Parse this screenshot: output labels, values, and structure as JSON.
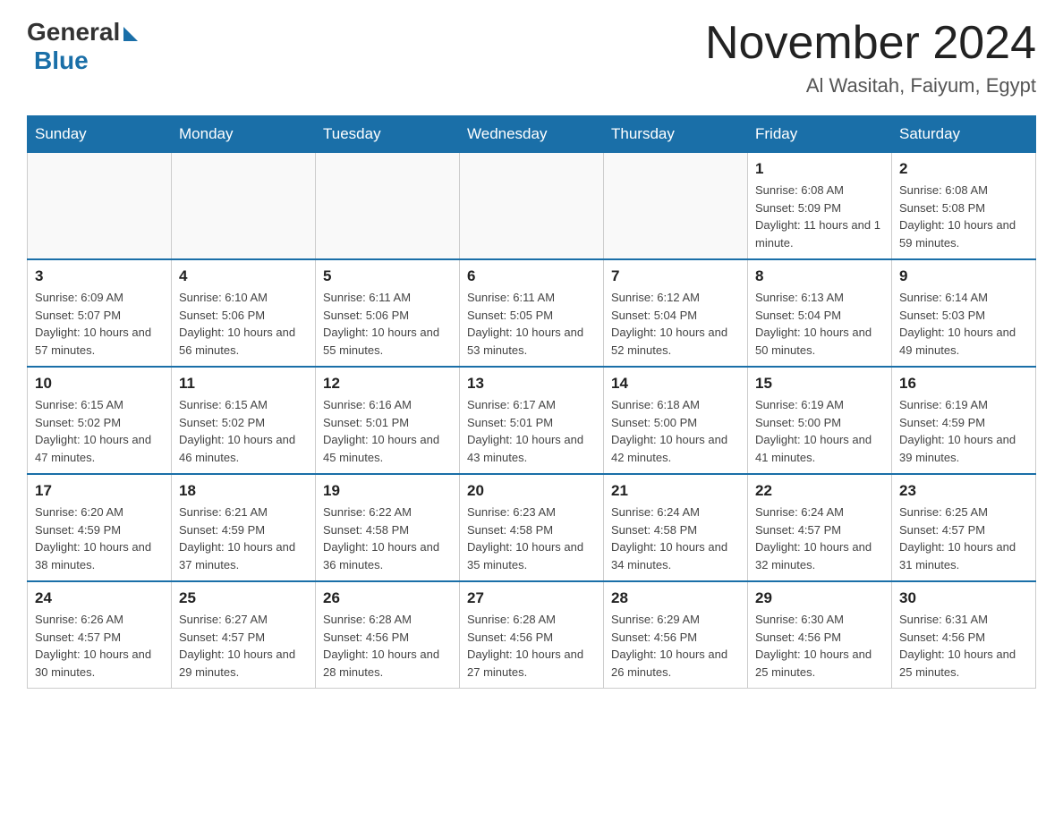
{
  "header": {
    "logo_general": "General",
    "logo_blue": "Blue",
    "month_year": "November 2024",
    "location": "Al Wasitah, Faiyum, Egypt"
  },
  "days_of_week": [
    "Sunday",
    "Monday",
    "Tuesday",
    "Wednesday",
    "Thursday",
    "Friday",
    "Saturday"
  ],
  "weeks": [
    [
      {
        "day": "",
        "info": ""
      },
      {
        "day": "",
        "info": ""
      },
      {
        "day": "",
        "info": ""
      },
      {
        "day": "",
        "info": ""
      },
      {
        "day": "",
        "info": ""
      },
      {
        "day": "1",
        "info": "Sunrise: 6:08 AM\nSunset: 5:09 PM\nDaylight: 11 hours and 1 minute."
      },
      {
        "day": "2",
        "info": "Sunrise: 6:08 AM\nSunset: 5:08 PM\nDaylight: 10 hours and 59 minutes."
      }
    ],
    [
      {
        "day": "3",
        "info": "Sunrise: 6:09 AM\nSunset: 5:07 PM\nDaylight: 10 hours and 57 minutes."
      },
      {
        "day": "4",
        "info": "Sunrise: 6:10 AM\nSunset: 5:06 PM\nDaylight: 10 hours and 56 minutes."
      },
      {
        "day": "5",
        "info": "Sunrise: 6:11 AM\nSunset: 5:06 PM\nDaylight: 10 hours and 55 minutes."
      },
      {
        "day": "6",
        "info": "Sunrise: 6:11 AM\nSunset: 5:05 PM\nDaylight: 10 hours and 53 minutes."
      },
      {
        "day": "7",
        "info": "Sunrise: 6:12 AM\nSunset: 5:04 PM\nDaylight: 10 hours and 52 minutes."
      },
      {
        "day": "8",
        "info": "Sunrise: 6:13 AM\nSunset: 5:04 PM\nDaylight: 10 hours and 50 minutes."
      },
      {
        "day": "9",
        "info": "Sunrise: 6:14 AM\nSunset: 5:03 PM\nDaylight: 10 hours and 49 minutes."
      }
    ],
    [
      {
        "day": "10",
        "info": "Sunrise: 6:15 AM\nSunset: 5:02 PM\nDaylight: 10 hours and 47 minutes."
      },
      {
        "day": "11",
        "info": "Sunrise: 6:15 AM\nSunset: 5:02 PM\nDaylight: 10 hours and 46 minutes."
      },
      {
        "day": "12",
        "info": "Sunrise: 6:16 AM\nSunset: 5:01 PM\nDaylight: 10 hours and 45 minutes."
      },
      {
        "day": "13",
        "info": "Sunrise: 6:17 AM\nSunset: 5:01 PM\nDaylight: 10 hours and 43 minutes."
      },
      {
        "day": "14",
        "info": "Sunrise: 6:18 AM\nSunset: 5:00 PM\nDaylight: 10 hours and 42 minutes."
      },
      {
        "day": "15",
        "info": "Sunrise: 6:19 AM\nSunset: 5:00 PM\nDaylight: 10 hours and 41 minutes."
      },
      {
        "day": "16",
        "info": "Sunrise: 6:19 AM\nSunset: 4:59 PM\nDaylight: 10 hours and 39 minutes."
      }
    ],
    [
      {
        "day": "17",
        "info": "Sunrise: 6:20 AM\nSunset: 4:59 PM\nDaylight: 10 hours and 38 minutes."
      },
      {
        "day": "18",
        "info": "Sunrise: 6:21 AM\nSunset: 4:59 PM\nDaylight: 10 hours and 37 minutes."
      },
      {
        "day": "19",
        "info": "Sunrise: 6:22 AM\nSunset: 4:58 PM\nDaylight: 10 hours and 36 minutes."
      },
      {
        "day": "20",
        "info": "Sunrise: 6:23 AM\nSunset: 4:58 PM\nDaylight: 10 hours and 35 minutes."
      },
      {
        "day": "21",
        "info": "Sunrise: 6:24 AM\nSunset: 4:58 PM\nDaylight: 10 hours and 34 minutes."
      },
      {
        "day": "22",
        "info": "Sunrise: 6:24 AM\nSunset: 4:57 PM\nDaylight: 10 hours and 32 minutes."
      },
      {
        "day": "23",
        "info": "Sunrise: 6:25 AM\nSunset: 4:57 PM\nDaylight: 10 hours and 31 minutes."
      }
    ],
    [
      {
        "day": "24",
        "info": "Sunrise: 6:26 AM\nSunset: 4:57 PM\nDaylight: 10 hours and 30 minutes."
      },
      {
        "day": "25",
        "info": "Sunrise: 6:27 AM\nSunset: 4:57 PM\nDaylight: 10 hours and 29 minutes."
      },
      {
        "day": "26",
        "info": "Sunrise: 6:28 AM\nSunset: 4:56 PM\nDaylight: 10 hours and 28 minutes."
      },
      {
        "day": "27",
        "info": "Sunrise: 6:28 AM\nSunset: 4:56 PM\nDaylight: 10 hours and 27 minutes."
      },
      {
        "day": "28",
        "info": "Sunrise: 6:29 AM\nSunset: 4:56 PM\nDaylight: 10 hours and 26 minutes."
      },
      {
        "day": "29",
        "info": "Sunrise: 6:30 AM\nSunset: 4:56 PM\nDaylight: 10 hours and 25 minutes."
      },
      {
        "day": "30",
        "info": "Sunrise: 6:31 AM\nSunset: 4:56 PM\nDaylight: 10 hours and 25 minutes."
      }
    ]
  ]
}
